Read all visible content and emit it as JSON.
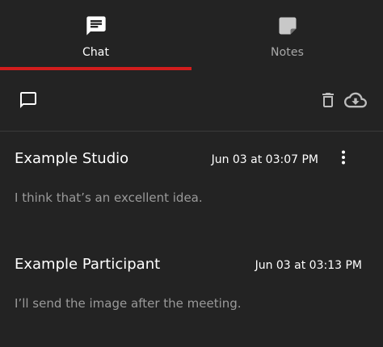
{
  "tabs": [
    {
      "label": "Chat",
      "icon": "chat-bubble-icon",
      "active": true
    },
    {
      "label": "Notes",
      "icon": "note-icon",
      "active": false
    }
  ],
  "colors": {
    "background": "#232323",
    "accent": "#d21d1d",
    "text_primary": "#ffffff",
    "text_secondary": "#9a9a9a",
    "inactive_tab": "#a9a9a9"
  },
  "toolbar": {
    "left_icon": "new-chat-icon",
    "right_icons": [
      "trash-icon",
      "cloud-download-icon"
    ]
  },
  "messages": [
    {
      "sender": "Example Studio",
      "time": "Jun 03 at 03:07 PM",
      "text": "I think that’s an excellent idea.",
      "has_menu": true
    },
    {
      "sender": "Example Participant",
      "time": "Jun 03 at 03:13 PM",
      "text": "I’ll send the image after the meeting.",
      "has_menu": false
    }
  ]
}
